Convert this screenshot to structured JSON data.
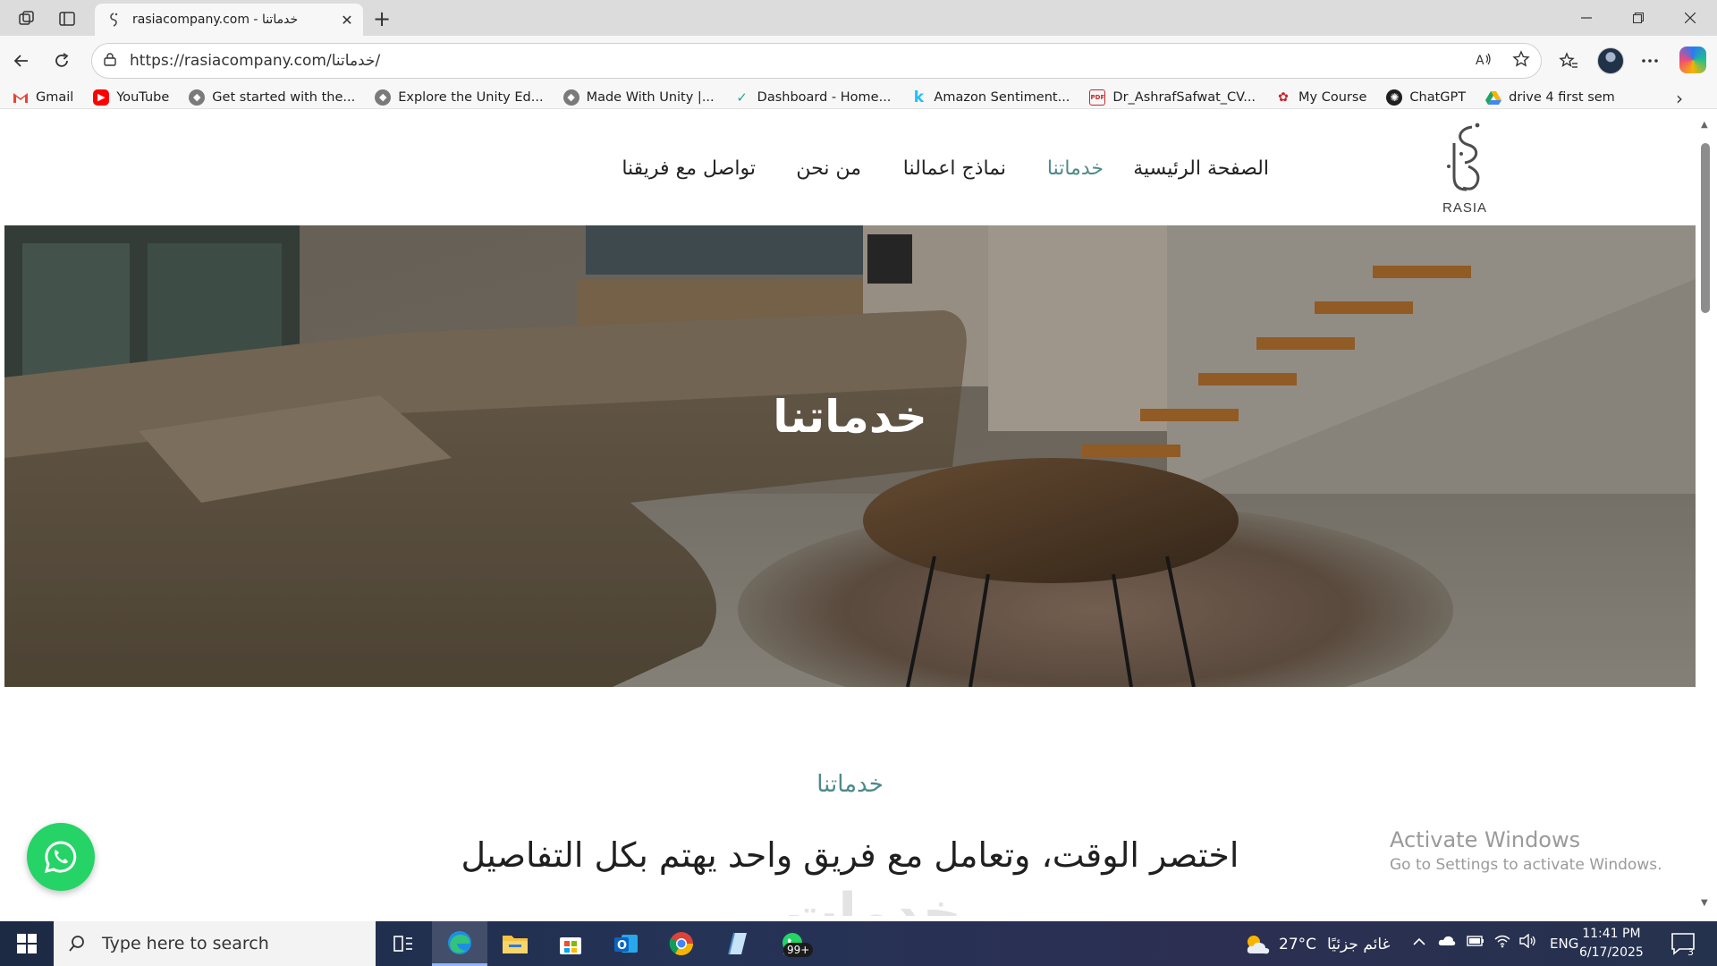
{
  "browser": {
    "tab_title": "rasiacompany.com - خدماتنا",
    "url": "https://rasiacompany.com/خدماتنا/",
    "bookmarks": [
      {
        "label": "Gmail",
        "icon": "gmail-icon",
        "color": "#ea4335"
      },
      {
        "label": "YouTube",
        "icon": "youtube-icon",
        "color": "#ff0000"
      },
      {
        "label": "Get started with the...",
        "icon": "unity-icon",
        "color": "#6e6e6e"
      },
      {
        "label": "Explore the Unity Ed...",
        "icon": "unity-icon",
        "color": "#6e6e6e"
      },
      {
        "label": "Made With Unity |...",
        "icon": "unity-icon",
        "color": "#6e6e6e"
      },
      {
        "label": "Dashboard - Home...",
        "icon": "dashboard-icon",
        "color": "#2aa39a"
      },
      {
        "label": "Amazon Sentiment...",
        "icon": "kaggle-icon",
        "color": "#20beff"
      },
      {
        "label": "Dr_AshrafSafwat_CV...",
        "icon": "pdf-icon",
        "color": "#c62828"
      },
      {
        "label": "My Course",
        "icon": "huawei-icon",
        "color": "#cf1f2b"
      },
      {
        "label": "ChatGPT",
        "icon": "chatgpt-icon",
        "color": "#1f1f1f"
      },
      {
        "label": "drive 4 first sem",
        "icon": "google-drive-icon",
        "color": "#1fa463"
      }
    ]
  },
  "site": {
    "logo_text": "RASIA",
    "nav": [
      {
        "label": "الصفحة الرئيسية",
        "active": false
      },
      {
        "label": "خدماتنا",
        "active": true
      },
      {
        "label": "نماذج اعمالنا",
        "active": false
      },
      {
        "label": "من نحن",
        "active": false
      },
      {
        "label": "تواصل مع فريقنا",
        "active": false
      }
    ],
    "hero_title": "خدماتنا",
    "section_subtitle": "خدماتنا",
    "section_heading": "اختصر الوقت، وتعامل مع فريق واحد يهتم بكل التفاصيل",
    "ghost_text": "خدمات",
    "accent_color": "#4e8a8b"
  },
  "watermark": {
    "line1": "Activate Windows",
    "line2": "Go to Settings to activate Windows."
  },
  "taskbar": {
    "search_placeholder": "Type here to search",
    "whatsapp_badge": "99+",
    "weather_temp": "27°C",
    "weather_desc": "غائم جزئيًا",
    "language": "ENG",
    "time": "11:41 PM",
    "date": "6/17/2025",
    "notification_count": "3"
  }
}
